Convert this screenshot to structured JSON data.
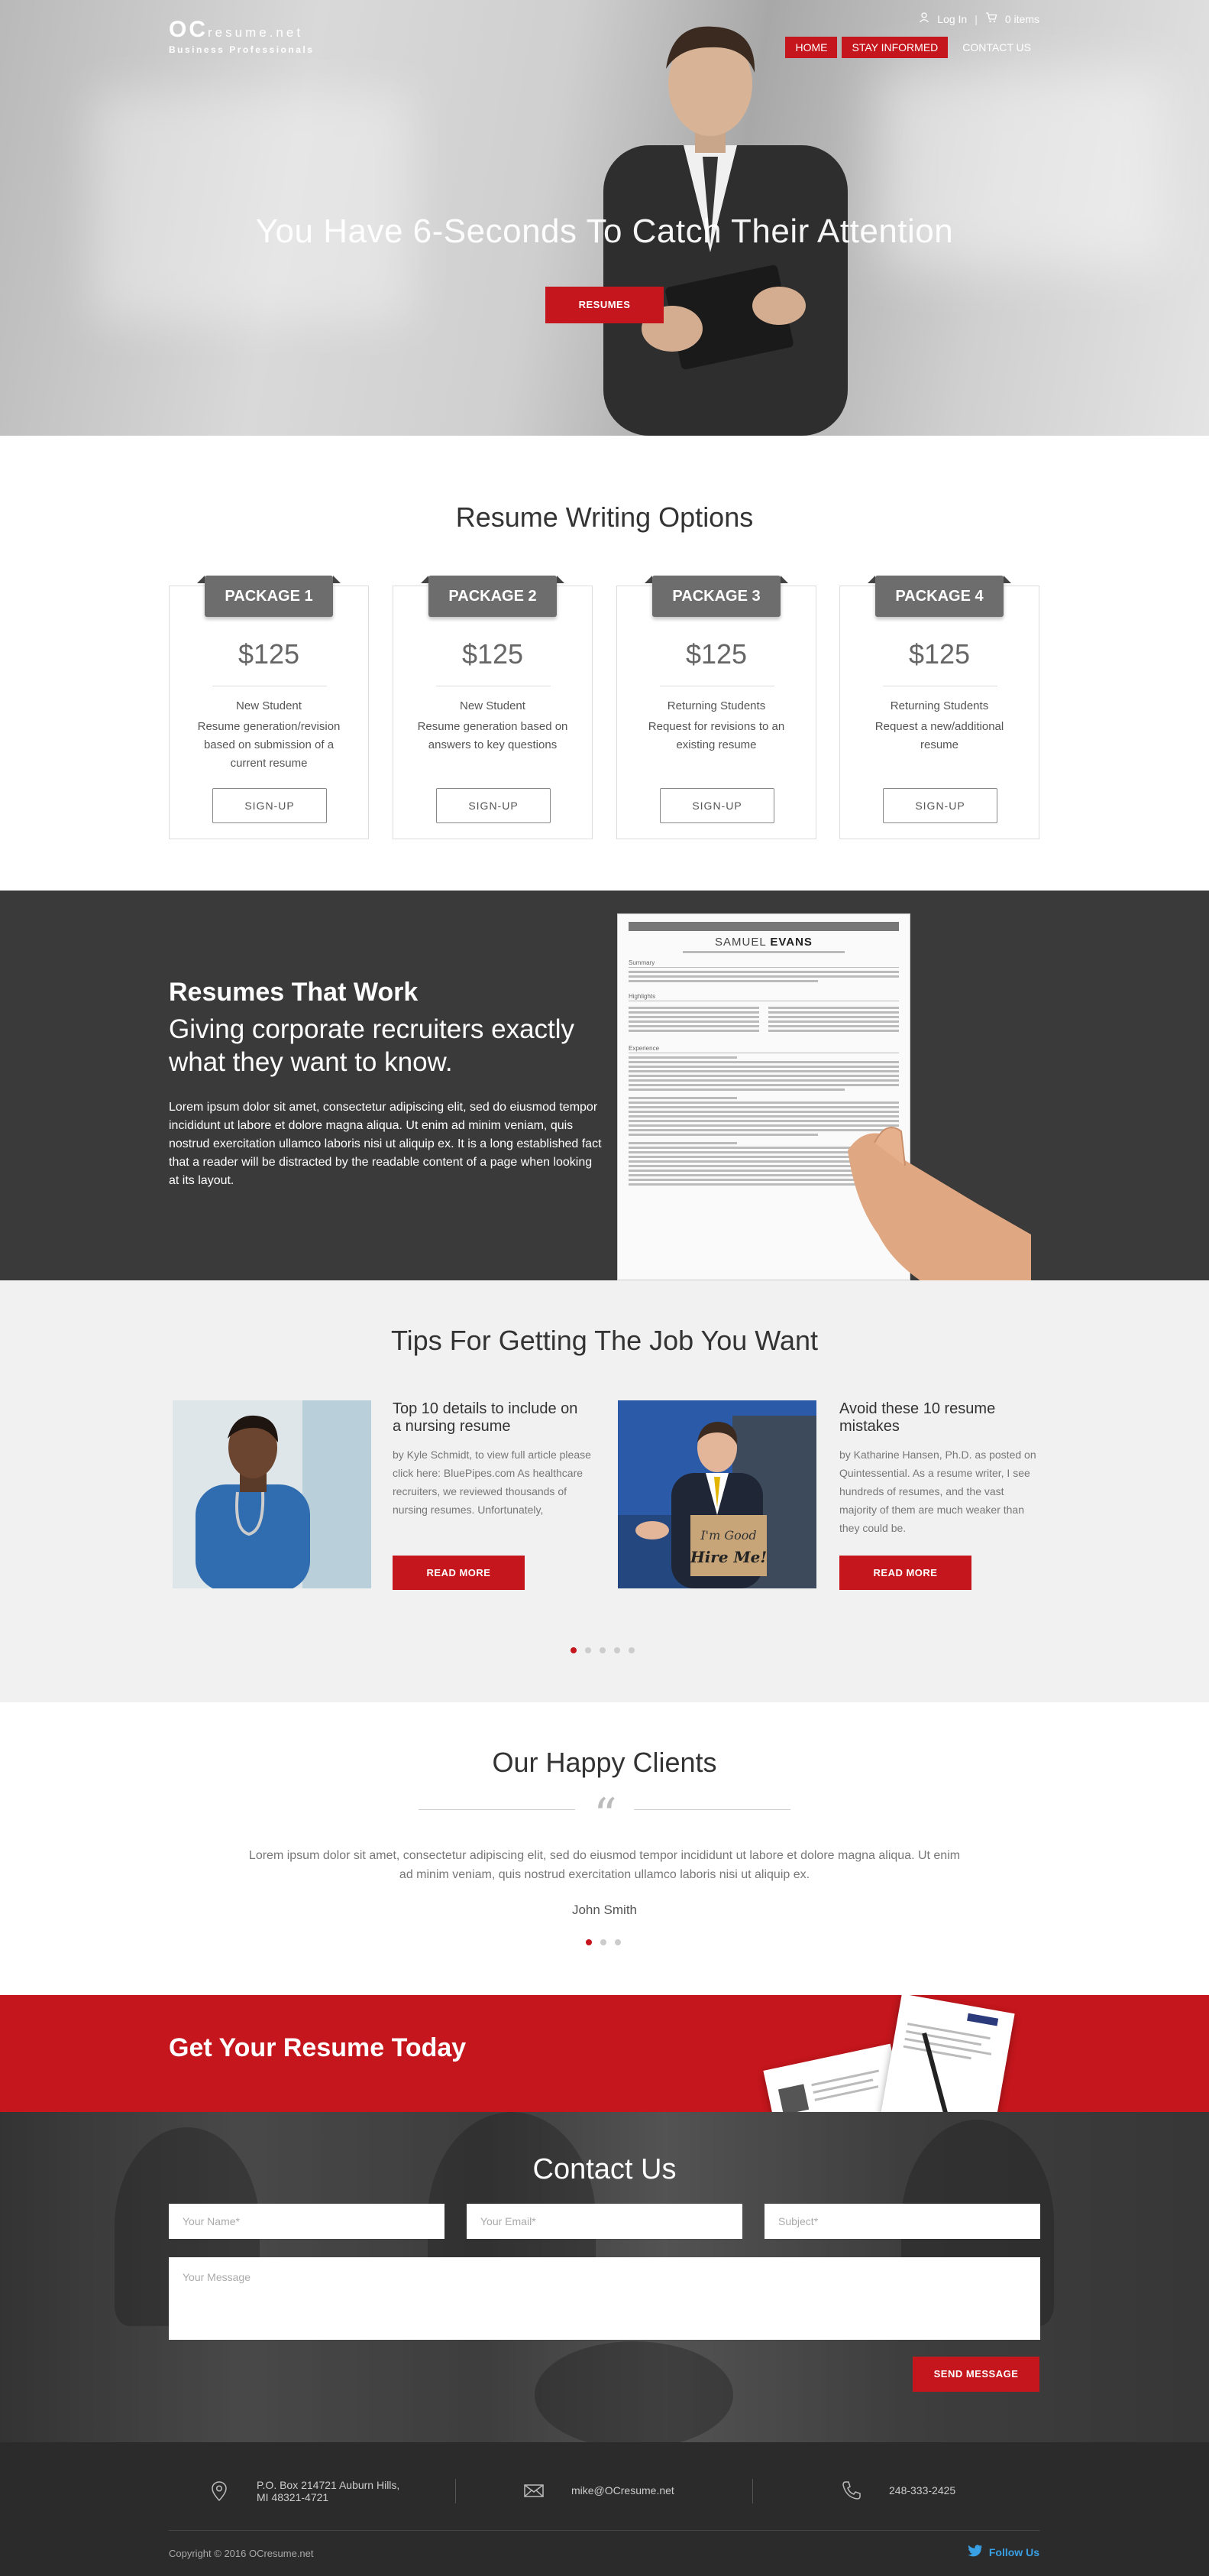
{
  "header": {
    "logo_main": "OC",
    "logo_domain": "resume.net",
    "logo_tagline": "Business Professionals",
    "login": "Log In",
    "separator": "|",
    "cart": "0 items",
    "nav": [
      {
        "label": "HOME",
        "active": true
      },
      {
        "label": "STAY INFORMED",
        "active": true
      },
      {
        "label": "CONTACT US",
        "active": false
      }
    ]
  },
  "hero": {
    "title": "You Have 6-Seconds To Catch Their Attention",
    "button": "RESUMES"
  },
  "packages": {
    "title": "Resume Writing Options",
    "items": [
      {
        "name": "PACKAGE 1",
        "price": "$125",
        "audience": "New Student",
        "desc": "Resume generation/revision based on submission of a current resume",
        "button": "SIGN-UP"
      },
      {
        "name": "PACKAGE 2",
        "price": "$125",
        "audience": "New Student",
        "desc": "Resume generation based on answers to key questions",
        "button": "SIGN-UP"
      },
      {
        "name": "PACKAGE 3",
        "price": "$125",
        "audience": "Returning Students",
        "desc": "Request for revisions to an existing resume",
        "button": "SIGN-UP"
      },
      {
        "name": "PACKAGE 4",
        "price": "$125",
        "audience": "Returning Students",
        "desc": "Request a new/additional resume",
        "button": "SIGN-UP"
      }
    ]
  },
  "work": {
    "heading": "Resumes That Work",
    "subheading": "Giving corporate recruiters exactly what they want to know.",
    "body": "Lorem ipsum dolor sit amet, consectetur adipiscing elit, sed do eiusmod tempor incididunt ut labore et dolore magna aliqua. Ut enim ad minim veniam, quis nostrud exercitation ullamco laboris nisi ut aliquip ex. It is a long established fact that a reader will be distracted by the readable content of a page when looking at its layout.",
    "resume_first": "SAMUEL",
    "resume_last": "EVANS",
    "resume_sections": [
      "Summary",
      "Highlights",
      "Experience"
    ]
  },
  "tips": {
    "title": "Tips For Getting The Job You Want",
    "articles": [
      {
        "title": "Top 10 details to include on a nursing resume",
        "text": "by Kyle Schmidt, to view full article please click here: BluePipes.com As healthcare recruiters, we reviewed thousands of nursing resumes. Unfortunately,",
        "button": "READ MORE"
      },
      {
        "title": "Avoid these 10 resume mistakes",
        "text": "by Katharine Hansen, Ph.D. as posted on Quintessential. As a resume writer, I see hundreds of resumes, and the vast majority of them are much weaker than they could be.",
        "button": "READ MORE",
        "sign_line1": "I'm Good",
        "sign_line2": "Hire Me!"
      }
    ]
  },
  "clients": {
    "title": "Our Happy Clients",
    "quote": "Lorem ipsum dolor sit amet, consectetur adipiscing elit, sed do eiusmod tempor incididunt ut labore et dolore magna aliqua. Ut enim ad minim veniam, quis nostrud exercitation ullamco laboris nisi ut aliquip ex.",
    "name": "John Smith"
  },
  "cta": {
    "title": "Get Your Resume Today"
  },
  "contact": {
    "title": "Contact Us",
    "name_placeholder": "Your Name*",
    "email_placeholder": "Your Email*",
    "subject_placeholder": "Subject*",
    "message_placeholder": "Your Message",
    "send": "SEND MESSAGE"
  },
  "footer": {
    "address_line1": "P.O. Box 214721 Auburn Hills,",
    "address_line2": "MI 48321-4721",
    "email": "mike@OCresume.net",
    "phone": "248-333-2425",
    "copyright": "Copyright © 2016 OCresume.net",
    "follow": "Follow Us"
  },
  "colors": {
    "accent": "#c4161c",
    "dark": "#3a3a3a",
    "footer": "#2b2b2b",
    "twitter": "#3aa0e6"
  }
}
